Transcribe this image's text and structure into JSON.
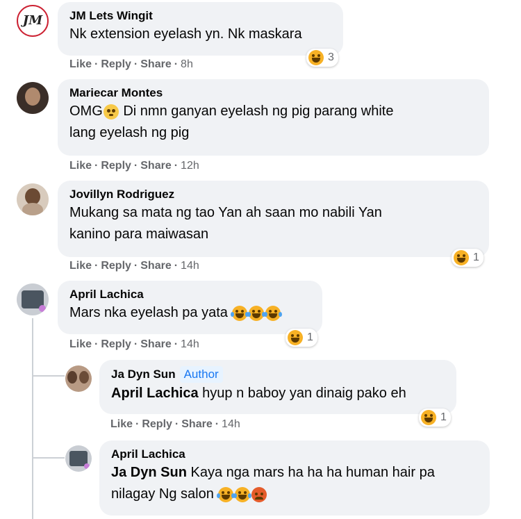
{
  "comments": [
    {
      "name": "JM Lets Wingit",
      "text": "Nk extension eyelash yn. Nk maskara",
      "actions": {
        "like": "Like",
        "reply": "Reply",
        "share": "Share",
        "time": "8h"
      },
      "reaction_count": "3",
      "avatar_initials": "JM"
    },
    {
      "name": "Mariecar Montes",
      "text_before_emoji": "OMG",
      "text_after_emoji": " Di nmn ganyan eyelash ng pig parang white",
      "text_line2": "lang eyelash ng pig",
      "actions": {
        "like": "Like",
        "reply": "Reply",
        "share": "Share",
        "time": "12h"
      }
    },
    {
      "name": "Jovillyn Rodriguez",
      "text_line1": "Mukang sa mata ng tao Yan ah saan mo nabili Yan",
      "text_line2": "kanino para maiwasan",
      "actions": {
        "like": "Like",
        "reply": "Reply",
        "share": "Share",
        "time": "14h"
      },
      "reaction_count": "1"
    },
    {
      "name": "April Lachica",
      "text": "Mars nka eyelash pa yata",
      "actions": {
        "like": "Like",
        "reply": "Reply",
        "share": "Share",
        "time": "14h"
      },
      "reaction_count": "1"
    }
  ],
  "replies": [
    {
      "name": "Ja Dyn Sun",
      "badge": "Author",
      "mention": "April Lachica",
      "text": " hyup n baboy yan dinaig pako eh",
      "actions": {
        "like": "Like",
        "reply": "Reply",
        "share": "Share",
        "time": "14h"
      },
      "reaction_count": "1"
    },
    {
      "name": "April Lachica",
      "mention": "Ja Dyn Sun",
      "text": " Kaya nga mars ha ha ha human hair pa",
      "text_line2": "nilagay Ng salon"
    }
  ],
  "colors": {
    "bubble": "#f0f2f5",
    "meta": "#65676b",
    "link": "#1877f2",
    "haha": "#f7b125",
    "angry": "#e45c2b"
  }
}
